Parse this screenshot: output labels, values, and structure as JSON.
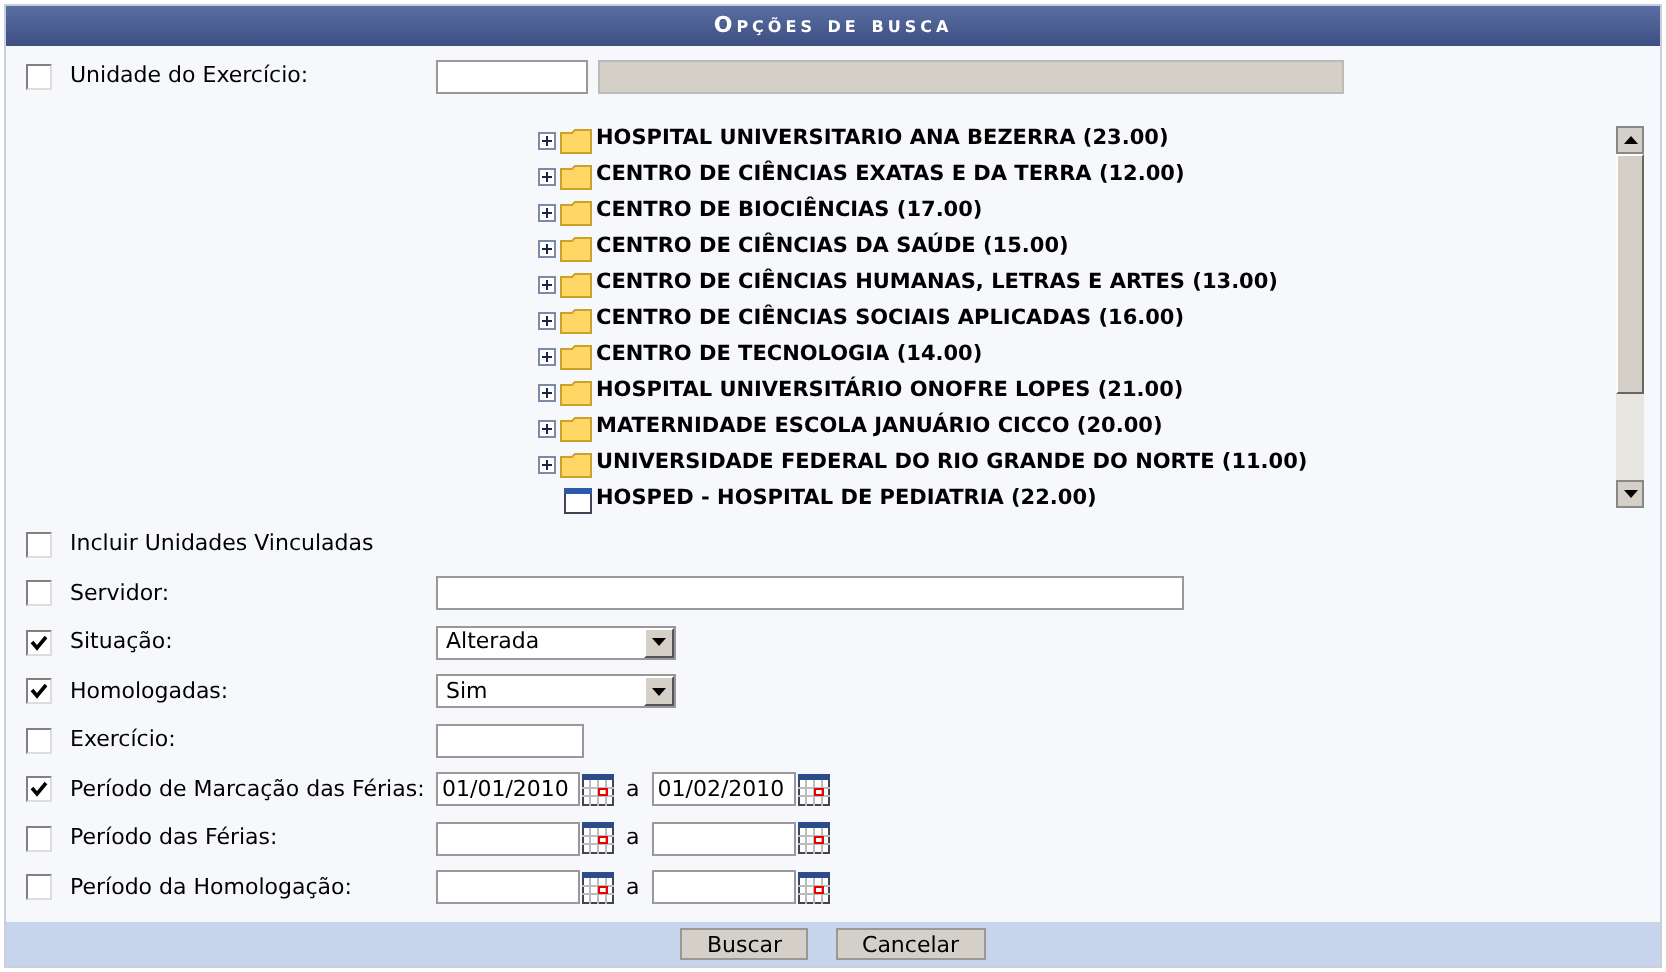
{
  "title": "Opções de busca",
  "unit_filter": {
    "label": "Unidade do Exercício:",
    "checked": false
  },
  "tree": [
    {
      "kind": "folder",
      "label": "HOSPITAL UNIVERSITARIO ANA BEZERRA (23.00)"
    },
    {
      "kind": "folder",
      "label": "CENTRO DE CIÊNCIAS EXATAS E DA TERRA (12.00)"
    },
    {
      "kind": "folder",
      "label": "CENTRO DE BIOCIÊNCIAS (17.00)"
    },
    {
      "kind": "folder",
      "label": "CENTRO DE CIÊNCIAS DA SAÚDE (15.00)"
    },
    {
      "kind": "folder",
      "label": "CENTRO DE CIÊNCIAS HUMANAS, LETRAS E ARTES (13.00)"
    },
    {
      "kind": "folder",
      "label": "CENTRO DE CIÊNCIAS SOCIAIS APLICADAS (16.00)"
    },
    {
      "kind": "folder",
      "label": "CENTRO DE TECNOLOGIA (14.00)"
    },
    {
      "kind": "folder",
      "label": "HOSPITAL UNIVERSITÁRIO ONOFRE LOPES (21.00)"
    },
    {
      "kind": "folder",
      "label": "MATERNIDADE ESCOLA JANUÁRIO CICCO (20.00)"
    },
    {
      "kind": "folder",
      "label": "UNIVERSIDADE FEDERAL DO RIO GRANDE DO NORTE (11.00)"
    },
    {
      "kind": "page",
      "label": "HOSPED - HOSPITAL DE PEDIATRIA (22.00)"
    }
  ],
  "filters": [
    {
      "kind": "none",
      "label": "Incluir Unidades Vinculadas",
      "checked": false
    },
    {
      "kind": "text",
      "label": "Servidor:",
      "checked": false
    },
    {
      "kind": "select",
      "label": "Situação:",
      "checked": true,
      "value": "Alterada"
    },
    {
      "kind": "select",
      "label": "Homologadas:",
      "checked": true,
      "value": "Sim"
    },
    {
      "kind": "short",
      "label": "Exercício:",
      "checked": false
    },
    {
      "kind": "daterange",
      "label": "Período de Marcação das Férias:",
      "checked": true,
      "from": "01/01/2010",
      "separator": "a",
      "to": "01/02/2010"
    },
    {
      "kind": "daterange",
      "label": "Período das Férias:",
      "checked": false,
      "separator": "a"
    },
    {
      "kind": "daterange",
      "label": "Período da Homologação:",
      "checked": false,
      "separator": "a"
    }
  ],
  "buttons": [
    "Buscar",
    "Cancelar"
  ]
}
